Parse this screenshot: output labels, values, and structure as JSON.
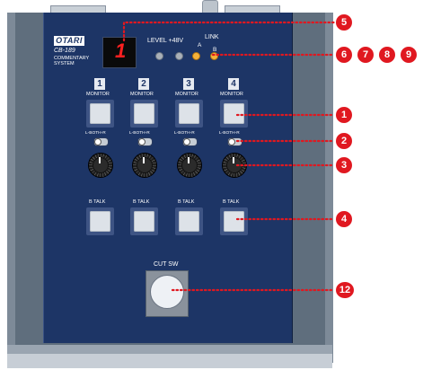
{
  "logo": "OTARI",
  "model": "CB-189",
  "system_line1": "COMMENTARY",
  "system_line2": "SYSTEM",
  "display_digit": "1",
  "indicators": {
    "level_label": "LEVEL +48V",
    "link_label": "LINK",
    "link_a": "A",
    "link_b": "B"
  },
  "channels": [
    {
      "number": "1",
      "monitor": "MONITOR",
      "bypass": "L-BOTH-R",
      "btalk": "B TALK"
    },
    {
      "number": "2",
      "monitor": "MONITOR",
      "bypass": "L-BOTH-R",
      "btalk": "B TALK"
    },
    {
      "number": "3",
      "monitor": "MONITOR",
      "bypass": "L-BOTH-R",
      "btalk": "B TALK"
    },
    {
      "number": "4",
      "monitor": "MONITOR",
      "bypass": "L-BOTH-R",
      "btalk": "B TALK"
    }
  ],
  "cut_sw": "CUT SW",
  "callouts": [
    "5",
    "6",
    "7",
    "8",
    "9",
    "1",
    "2",
    "3",
    "4",
    "12"
  ],
  "colors": {
    "panel": "#1d3566",
    "callout": "#e01820",
    "led_amber": "#f5b23a",
    "display": "#ff2020"
  }
}
